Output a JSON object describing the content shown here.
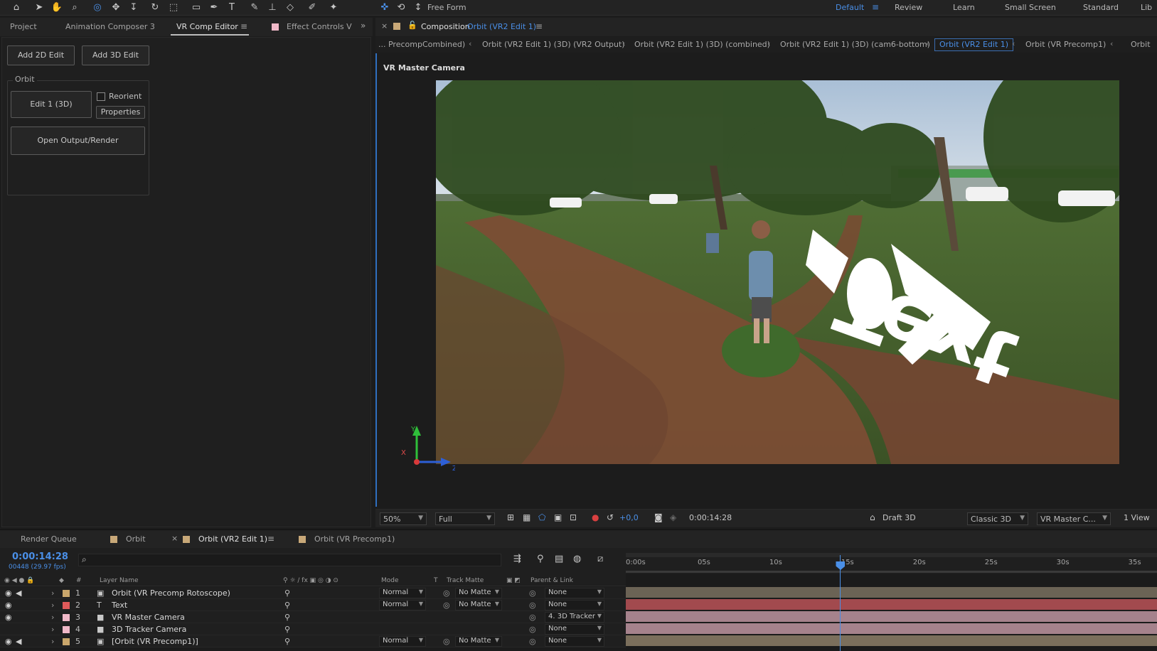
{
  "toolbar": {
    "free_form_label": "Free Form",
    "workspaces": [
      {
        "label": "Default",
        "active": true
      },
      {
        "label": "Review",
        "active": false
      },
      {
        "label": "Learn",
        "active": false
      },
      {
        "label": "Small Screen",
        "active": false
      },
      {
        "label": "Standard",
        "active": false
      },
      {
        "label": "Lib",
        "active": false
      }
    ]
  },
  "left_panel": {
    "tabs": [
      "Project",
      "Animation Composer 3",
      "VR Comp Editor",
      "Effect Controls V"
    ],
    "active_tab": "VR Comp Editor",
    "add_2d_label": "Add 2D Edit",
    "add_3d_label": "Add 3D Edit",
    "group_label": "Orbit",
    "edit_label": "Edit 1 (3D)",
    "reorient_label": "Reorient",
    "properties_label": "Properties",
    "open_output_label": "Open Output/Render"
  },
  "comp_panel": {
    "tab_prefix": "Composition",
    "tab_name": "Orbit (VR2 Edit 1)",
    "breadcrumbs": [
      {
        "label": "... PrecompCombined)",
        "active": false
      },
      {
        "label": "Orbit (VR2 Edit 1) (3D) (VR2 Output)",
        "active": false
      },
      {
        "label": "Orbit (VR2 Edit 1) (3D) (combined)",
        "active": false
      },
      {
        "label": "Orbit (VR2 Edit 1) (3D) (cam6-bottom)",
        "active": false
      },
      {
        "label": "Orbit (VR2 Edit 1)",
        "active": true
      },
      {
        "label": "Orbit (VR Precomp1)",
        "active": false
      },
      {
        "label": "Orbit",
        "active": false
      }
    ],
    "camera_label": "VR Master Camera",
    "scene_text": "Text",
    "axes": {
      "x": "X",
      "y": "Y",
      "z": "Z"
    },
    "footer": {
      "zoom": "50%",
      "resolution": "Full",
      "exposure": "+0,0",
      "timecode": "0:00:14:28",
      "draft": "Draft 3D",
      "renderer": "Classic 3D",
      "camera": "VR Master C...",
      "views": "1 View"
    }
  },
  "timeline": {
    "tabs": [
      {
        "label": "Render Queue",
        "swatch": ""
      },
      {
        "label": "Orbit",
        "swatch": "#c8a878"
      },
      {
        "label": "Orbit (VR2 Edit 1)",
        "swatch": "#c8a878",
        "active": true
      },
      {
        "label": "Orbit (VR Precomp1)",
        "swatch": "#c8a878"
      }
    ],
    "timecode": "0:00:14:28",
    "frames": "00448 (29.97 fps)",
    "columns": {
      "num": "#",
      "layer_name": "Layer Name",
      "mode": "Mode",
      "t": "T",
      "track_matte": "Track Matte",
      "parent": "Parent & Link"
    },
    "ruler": [
      "0:00s",
      "05s",
      "10s",
      "15s",
      "20s",
      "25s",
      "30s",
      "35s"
    ],
    "layers": [
      {
        "num": "1",
        "name": "Orbit (VR Precomp Rotoscope)",
        "color": "#c9a66b",
        "type": "precomp-icon",
        "mode": "Normal",
        "matte": "No Matte",
        "parent": "None",
        "track_color": "#6b6355"
      },
      {
        "num": "2",
        "name": "Text",
        "color": "#e05a5a",
        "type": "text-icon",
        "mode": "Normal",
        "matte": "No Matte",
        "parent": "None",
        "track_color": "#a24a4e"
      },
      {
        "num": "3",
        "name": "VR Master Camera",
        "color": "#f0b8c8",
        "type": "camera-icon",
        "mode": "",
        "matte": "",
        "parent": "4. 3D Tracker",
        "track_color": "#a5828c"
      },
      {
        "num": "4",
        "name": "3D Tracker Camera",
        "color": "#f0b8c8",
        "type": "camera-icon",
        "mode": "",
        "matte": "",
        "parent": "None",
        "track_color": "#a5828c"
      },
      {
        "num": "5",
        "name": "[Orbit (VR Precomp1)]",
        "color": "#c9a66b",
        "type": "precomp-icon",
        "mode": "Normal",
        "matte": "No Matte",
        "parent": "None",
        "track_color": "#7b6f5c"
      }
    ]
  }
}
